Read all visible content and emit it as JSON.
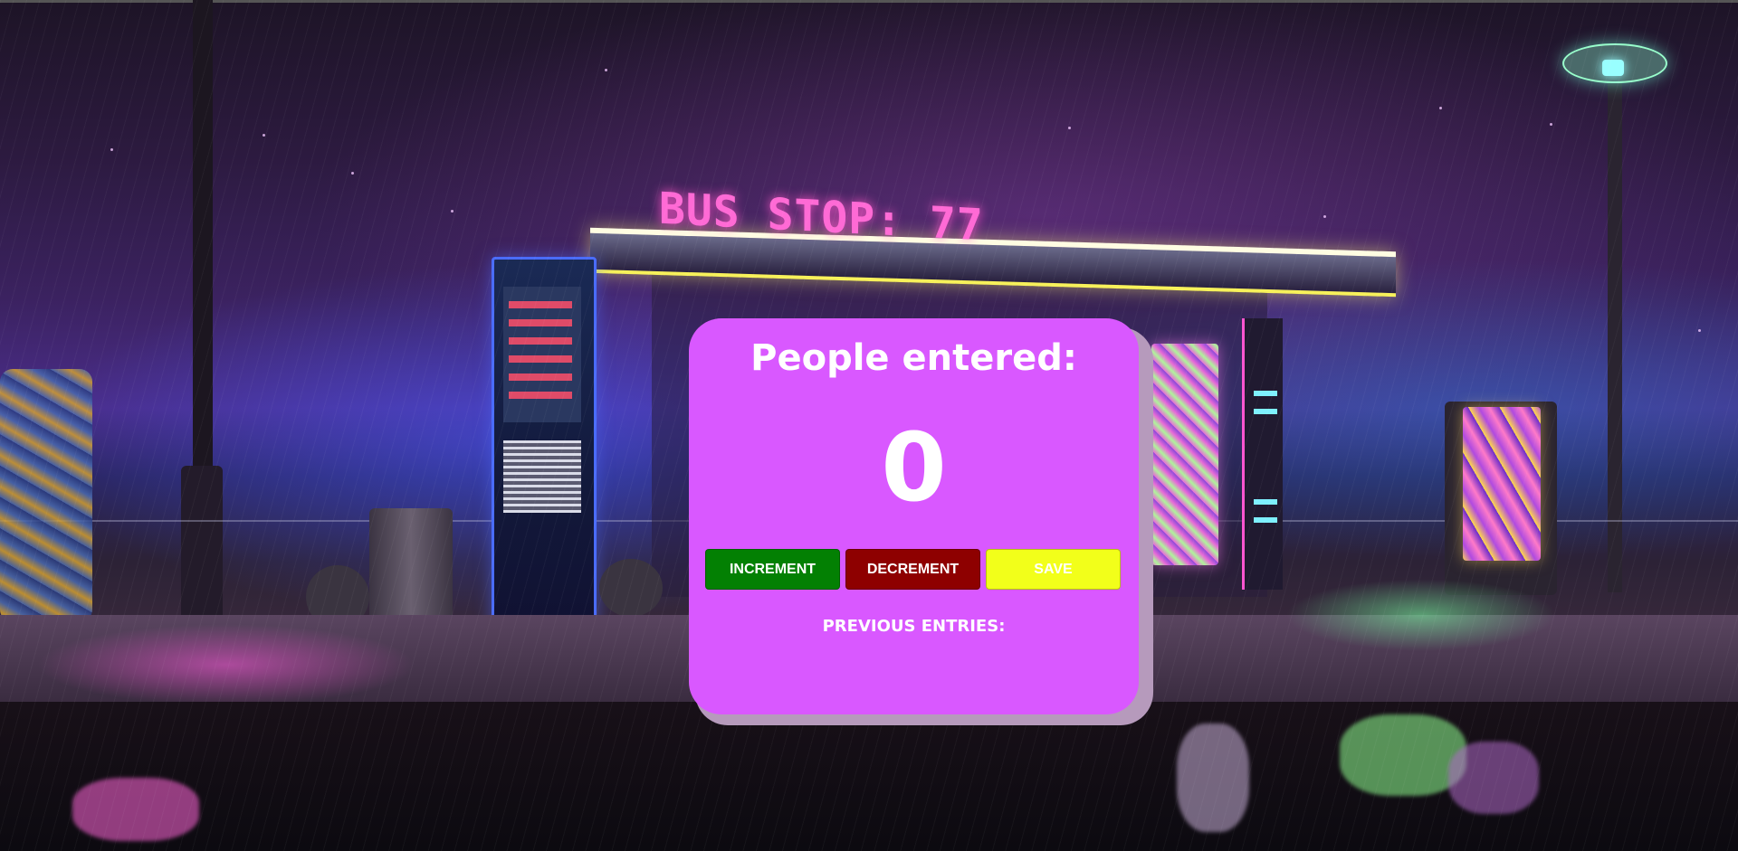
{
  "scene": {
    "sign_text": "BUS STOP: 77"
  },
  "counter": {
    "title": "People entered:",
    "count": "0",
    "increment_label": "INCREMENT",
    "decrement_label": "DECREMENT",
    "save_label": "SAVE",
    "previous_entries_label": "PREVIOUS ENTRIES:",
    "previous_entries": []
  },
  "colors": {
    "card_background": "#d958ff",
    "card_shadow": "#b69abc",
    "increment_button": "#038003",
    "decrement_button": "#8e0000",
    "save_button": "#f2ff1a",
    "text": "#ffffff"
  }
}
